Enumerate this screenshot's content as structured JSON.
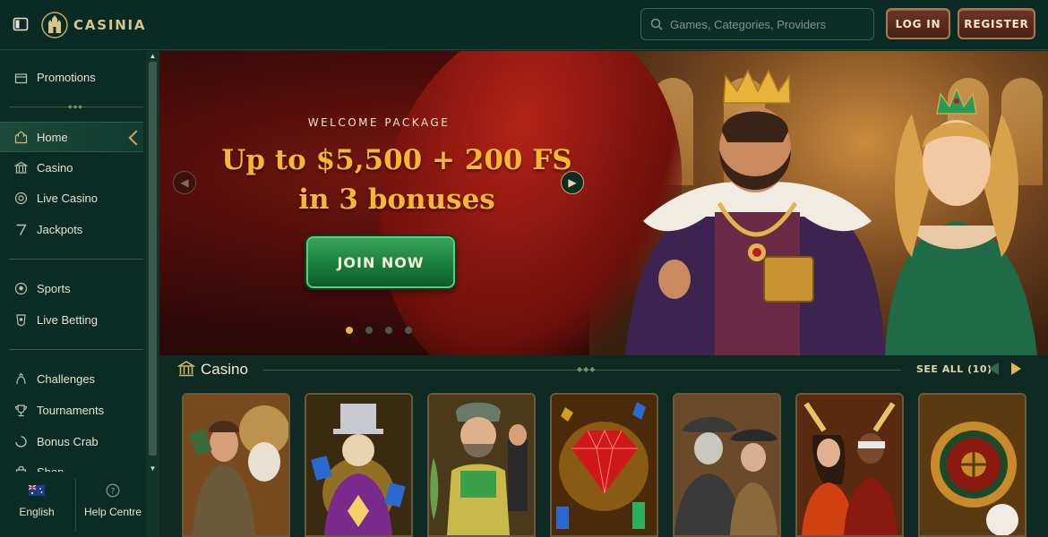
{
  "header": {
    "brand": "CASINIA",
    "search_placeholder": "Games, Categories, Providers",
    "login_label": "LOG IN",
    "register_label": "REGISTER"
  },
  "sidebar": {
    "items": [
      {
        "label": "Promotions",
        "icon": "gift-box-icon"
      },
      {
        "label": "Home",
        "icon": "castle-icon",
        "active": true
      },
      {
        "label": "Casino",
        "icon": "casino-building-icon"
      },
      {
        "label": "Live Casino",
        "icon": "live-chip-icon"
      },
      {
        "label": "Jackpots",
        "icon": "seven-icon"
      },
      {
        "label": "Sports",
        "icon": "soccer-ball-icon"
      },
      {
        "label": "Live Betting",
        "icon": "live-betting-icon"
      },
      {
        "label": "Challenges",
        "icon": "challenge-icon"
      },
      {
        "label": "Tournaments",
        "icon": "trophy-icon"
      },
      {
        "label": "Bonus Crab",
        "icon": "crab-icon"
      },
      {
        "label": "Shop",
        "icon": "shop-bag-icon"
      }
    ],
    "footer": {
      "language_label": "English",
      "help_label": "Help Centre"
    }
  },
  "banner": {
    "kicker": "WELCOME PACKAGE",
    "title_line1": "Up to $5,500 + 200 FS",
    "title_line2": "in 3 bonuses",
    "cta_label": "JOIN NOW",
    "slide_count": 4,
    "active_slide": 1
  },
  "casino_section": {
    "title": "Casino",
    "see_all_label": "SEE ALL (10)",
    "games": [
      {
        "name": "explorer-slot"
      },
      {
        "name": "magician-slot"
      },
      {
        "name": "fisherman-slot"
      },
      {
        "name": "red-diamond-slot"
      },
      {
        "name": "outlaws-slot"
      },
      {
        "name": "vegas-nights-slot"
      },
      {
        "name": "roulette-slot"
      }
    ]
  },
  "colors": {
    "background": "#0b2a22",
    "accent_gold": "#e9b64a",
    "cta_green": "#177a3a",
    "header_button": "#6d3526"
  }
}
